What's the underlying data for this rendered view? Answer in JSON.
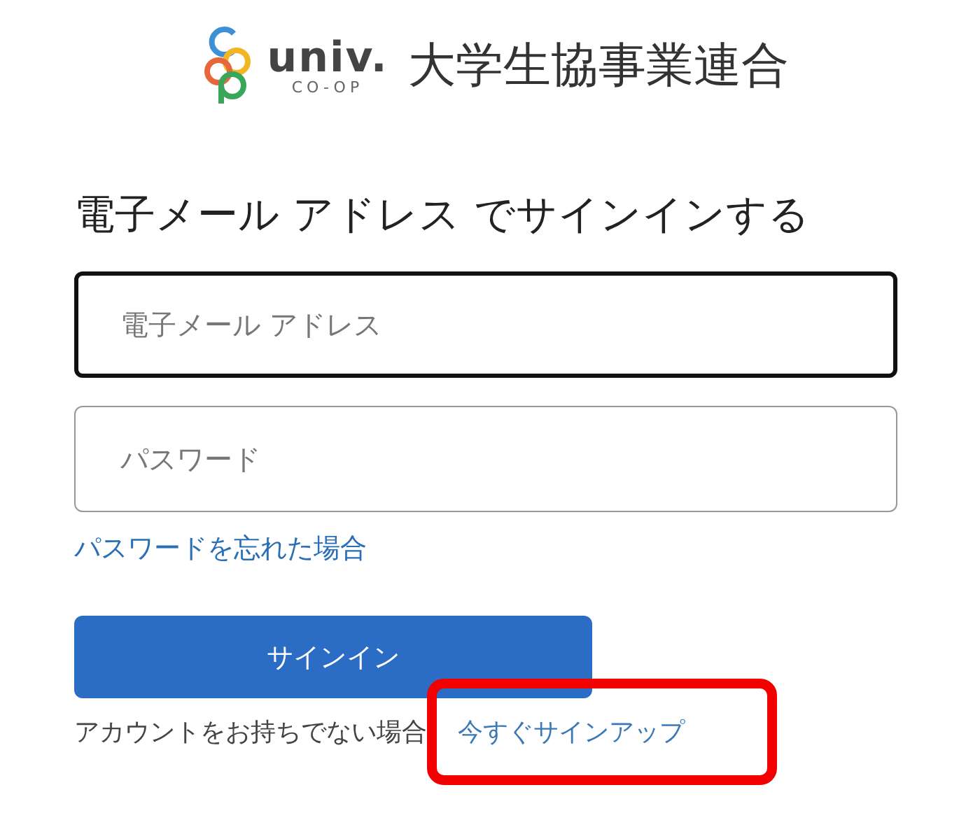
{
  "logo": {
    "wordmark": "univ.",
    "subtext": "CO-OP",
    "organization": "大学生協事業連合"
  },
  "heading": "電子メール アドレス でサインインする",
  "fields": [
    {
      "placeholder": "電子メール アドレス",
      "focused": true
    },
    {
      "placeholder": "パスワード",
      "focused": false
    }
  ],
  "forgot_link": "パスワードを忘れた場合",
  "signin_button": "サインイン",
  "signup": {
    "prompt": "アカウントをお持ちでない場合",
    "link": "今すぐサインアップ",
    "highlighted": true
  }
}
